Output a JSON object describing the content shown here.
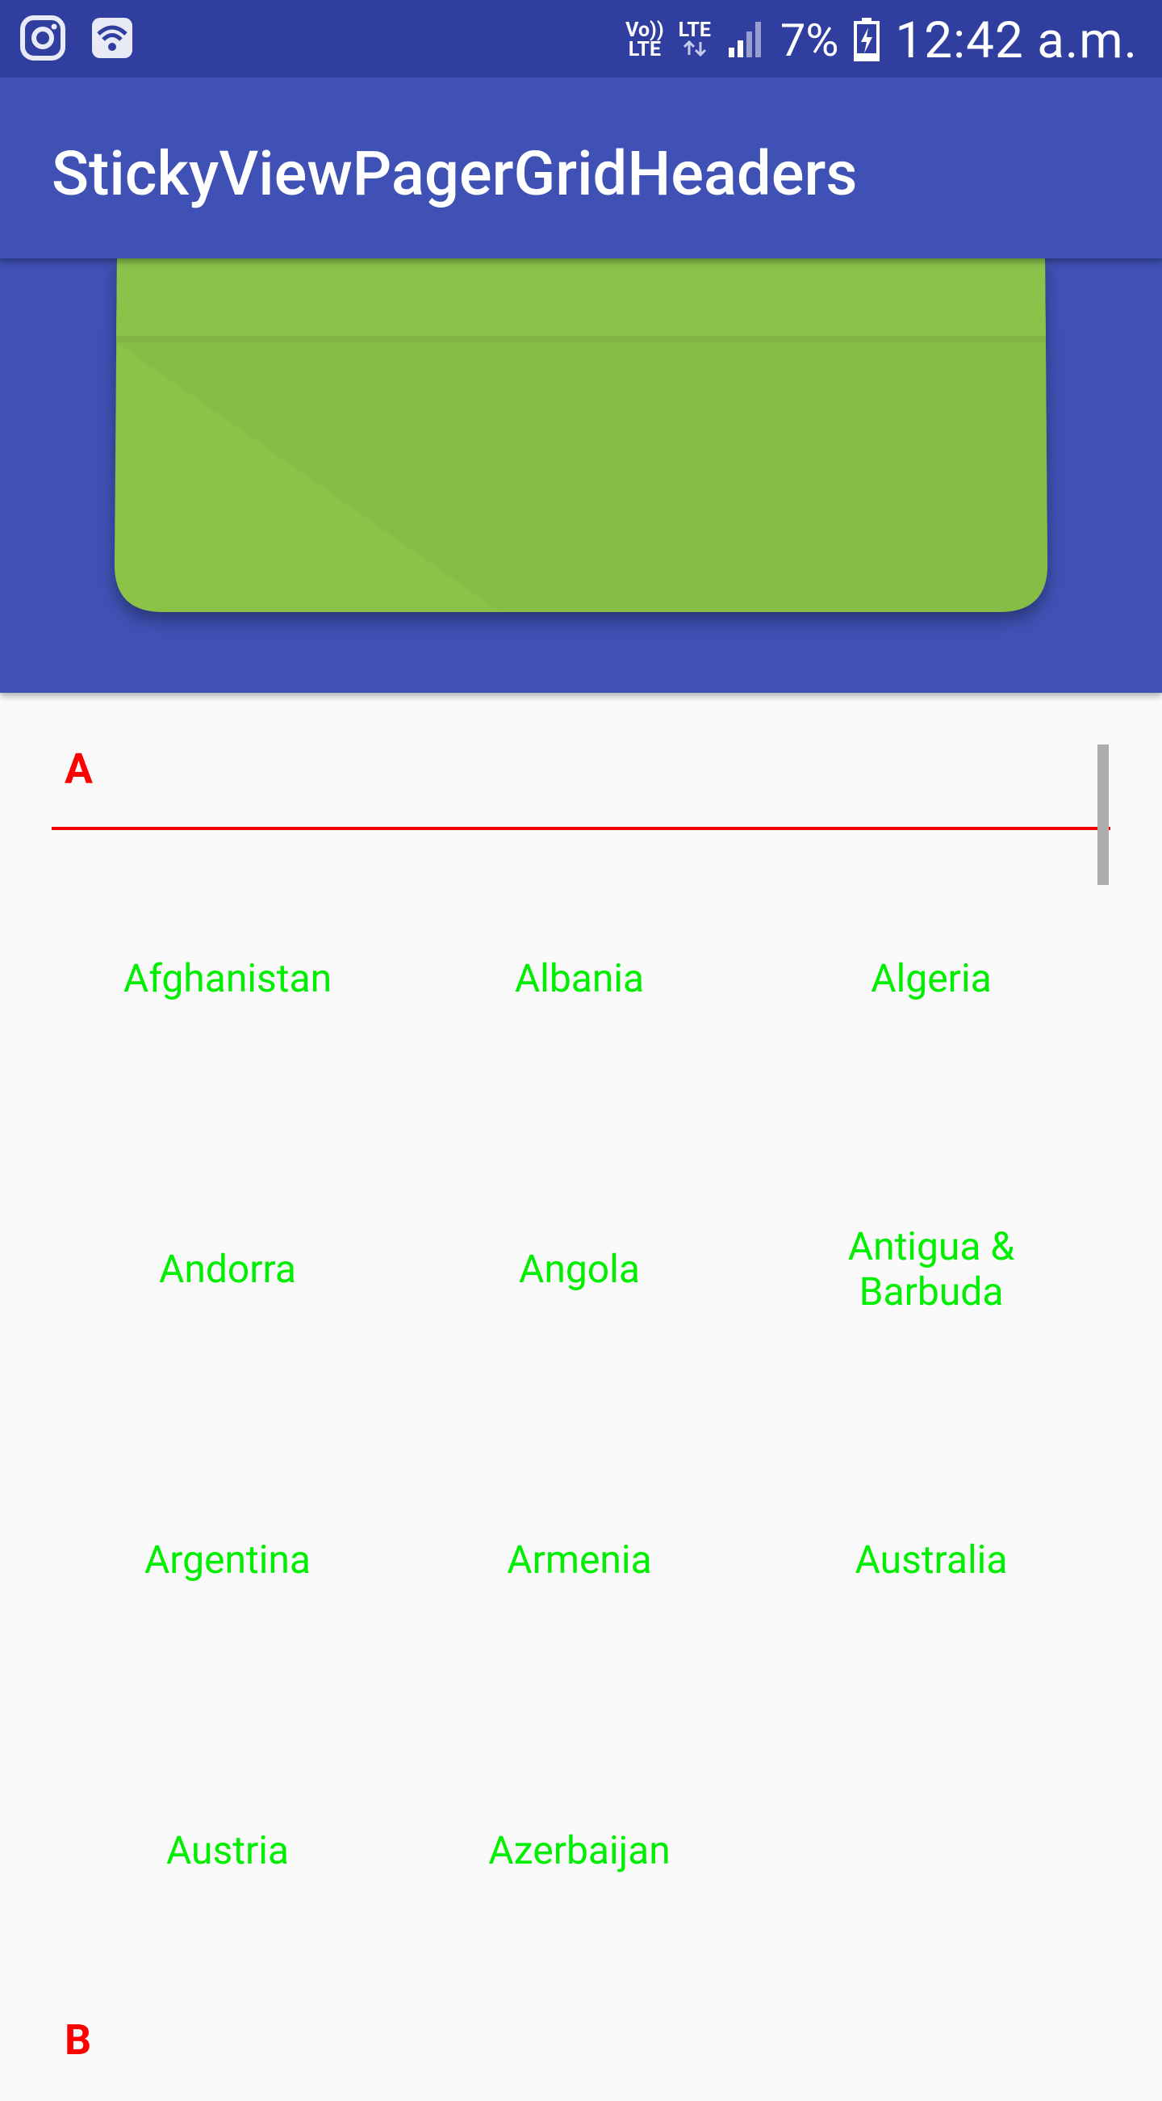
{
  "status_bar": {
    "icons_left": [
      "instagram-icon",
      "wifi-call-icon"
    ],
    "volte_line1": "Vo))",
    "volte_line2": "LTE",
    "lte_label": "LTE",
    "battery_percent": "7%",
    "time": "12:42 a.m."
  },
  "app_bar": {
    "title": "StickyViewPagerGridHeaders"
  },
  "banner": {
    "illustration": "green-card",
    "colors": {
      "background": "#3f51b5",
      "card": "#8bc34a"
    }
  },
  "sections": [
    {
      "letter": "A",
      "items": [
        "Afghanistan",
        "Albania",
        "Algeria",
        "Andorra",
        "Angola",
        "Antigua & Barbuda",
        "Argentina",
        "Armenia",
        "Australia",
        "Austria",
        "Azerbaijan"
      ]
    },
    {
      "letter": "B",
      "items": []
    }
  ],
  "colors": {
    "header_letter": "#ff0000",
    "country_text": "#00ee00",
    "status_bar": "#303f9f",
    "app_bar": "#3f51b5"
  }
}
